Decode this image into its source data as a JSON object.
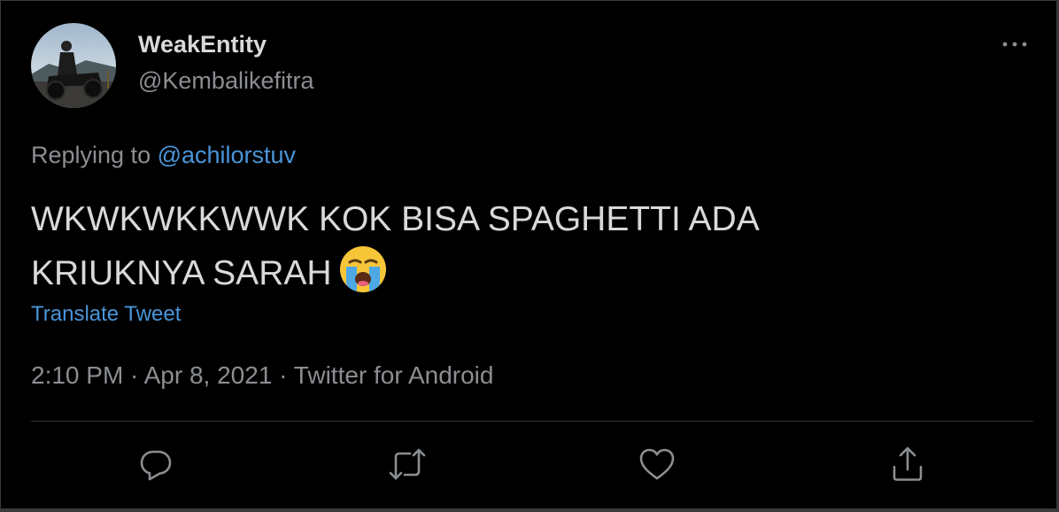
{
  "tweet": {
    "display_name": "WeakEntity",
    "handle": "@Kembalikefitra",
    "replying_prefix": "Replying to ",
    "replying_to": "@achilorstuv",
    "text_line1": "WKWKWKKWWK KOK BISA SPAGHETTI ADA",
    "text_line2": "KRIUKNYA SARAH",
    "emoji": "loudly-crying-face",
    "translate_label": "Translate Tweet",
    "time": "2:10 PM",
    "date": "Apr 8, 2021",
    "source": "Twitter for Android",
    "separator": " · "
  },
  "actions": {
    "reply_icon": "reply-icon",
    "retweet_icon": "retweet-icon",
    "like_icon": "like-icon",
    "share_icon": "share-icon",
    "more_icon": "more-icon"
  },
  "colors": {
    "background": "#000000",
    "primary_text": "#d9d9d9",
    "secondary_text": "#8b8e92",
    "link": "#4a95d9",
    "divider": "#2f3336"
  }
}
